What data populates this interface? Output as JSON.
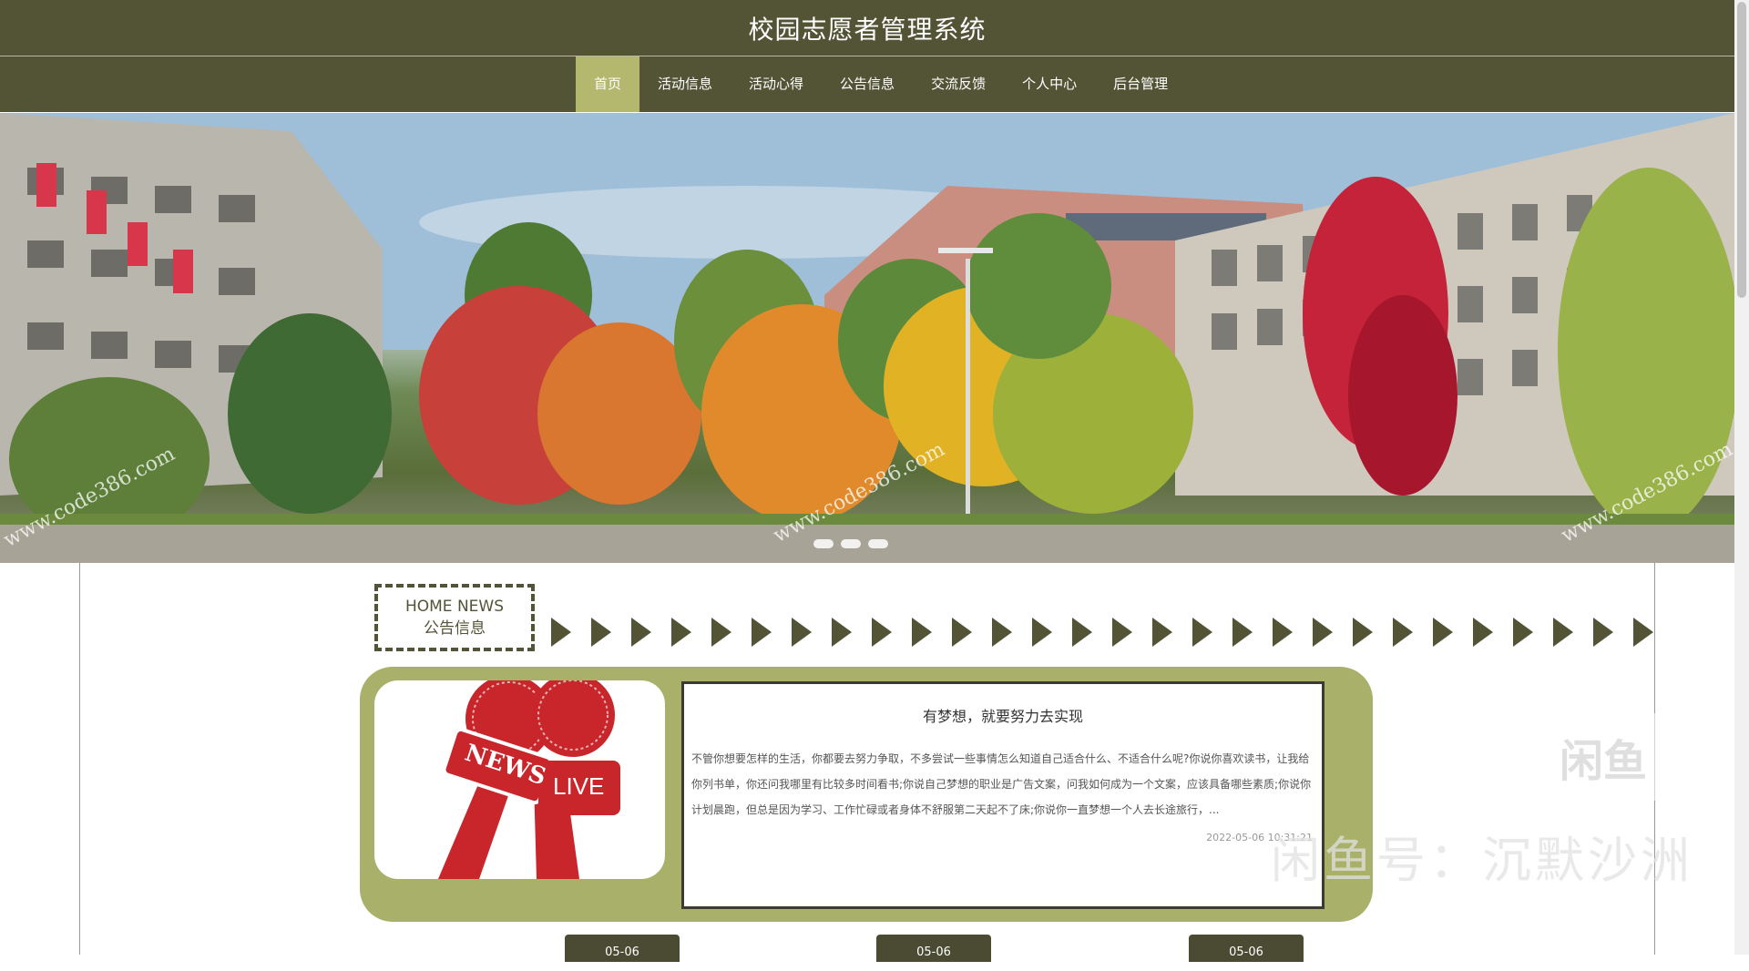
{
  "header": {
    "title": "校园志愿者管理系统"
  },
  "nav": {
    "items": [
      {
        "label": "首页",
        "active": true
      },
      {
        "label": "活动信息"
      },
      {
        "label": "活动心得"
      },
      {
        "label": "公告信息"
      },
      {
        "label": "交流反馈"
      },
      {
        "label": "个人中心"
      },
      {
        "label": "后台管理"
      }
    ]
  },
  "banner": {
    "watermarks": [
      "www.code386.com",
      "www.code386.com",
      "www.code386.com"
    ]
  },
  "news_section": {
    "label_en": "HOME NEWS",
    "label_cn": "公告信息"
  },
  "news_card": {
    "image_text_news": "NEWS",
    "image_text_live": "LIVE",
    "title": "有梦想，就要努力去实现",
    "body": "不管你想要怎样的生活，你都要去努力争取，不多尝试一些事情怎么知道自己适合什么、不适合什么呢?你说你喜欢读书，让我给你列书单，你还问我哪里有比较多时间看书;你说自己梦想的职业是广告文案，问我如何成为一个文案，应该具备哪些素质;你说你计划晨跑，但总是因为学习、工作忙碌或者身体不舒服第二天起不了床;你说你一直梦想一个人去长途旅行，...",
    "date": "2022-05-06 10:31:21"
  },
  "date_tabs": [
    "05-06",
    "05-06",
    "05-06"
  ],
  "overlay": {
    "badge": "闲鱼",
    "caption": "闲鱼号：沉默沙洲"
  },
  "colors": {
    "header_bg": "#535436",
    "nav_active": "#b3b86e",
    "card_bg": "#a9b06a"
  }
}
